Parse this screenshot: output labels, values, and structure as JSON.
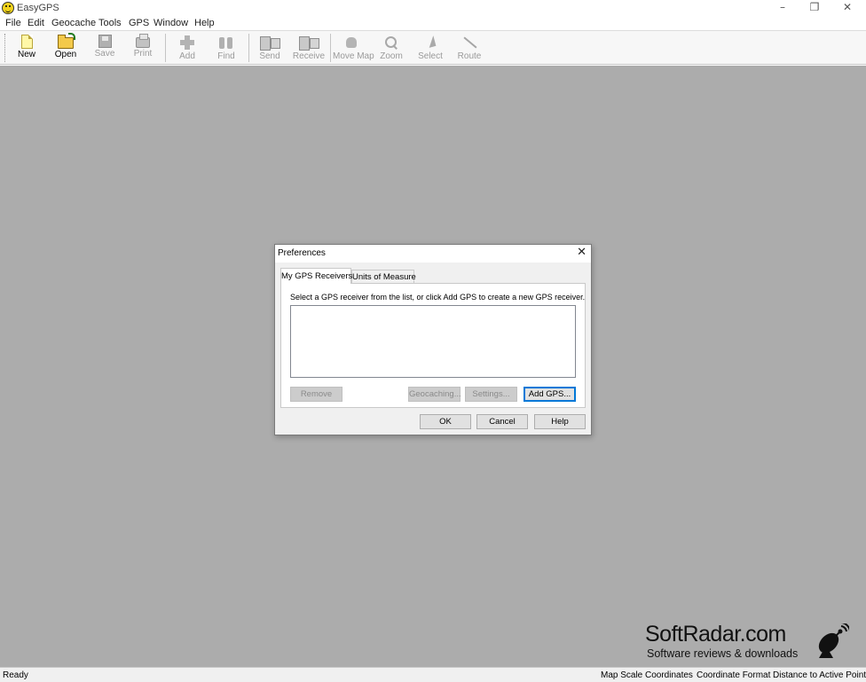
{
  "window": {
    "title": "EasyGPS",
    "controls": {
      "minimize": "–",
      "restore": "❐",
      "close": "✕"
    }
  },
  "menu": [
    "File",
    "Edit",
    "Geocache",
    "Tools",
    "GPS",
    "Window",
    "Help"
  ],
  "toolbar": {
    "new": "New",
    "open": "Open",
    "save": "Save",
    "print": "Print",
    "add": "Add",
    "find": "Find",
    "send": "Send",
    "receive": "Receive",
    "move_map": "Move Map",
    "zoom": "Zoom",
    "select": "Select",
    "route": "Route"
  },
  "dialog": {
    "title": "Preferences",
    "close": "✕",
    "tabs": [
      "My GPS Receivers",
      "Units of Measure"
    ],
    "instruction": "Select a GPS receiver from the list, or click Add GPS to create a new GPS receiver.",
    "buttons": {
      "remove": "Remove",
      "geocaching": "Geocaching...",
      "settings": "Settings...",
      "add_gps": "Add GPS...",
      "ok": "OK",
      "cancel": "Cancel",
      "help": "Help"
    }
  },
  "watermark": {
    "title": "SoftRadar.com",
    "subtitle": "Software reviews & downloads"
  },
  "status": {
    "ready": "Ready",
    "panes": [
      "Map Scale",
      "Coordinates",
      "Coordinate Format",
      "Distance to Active Point"
    ]
  },
  "colors": {
    "workspace": "#acacac",
    "accent_focus": "#0078d7"
  }
}
